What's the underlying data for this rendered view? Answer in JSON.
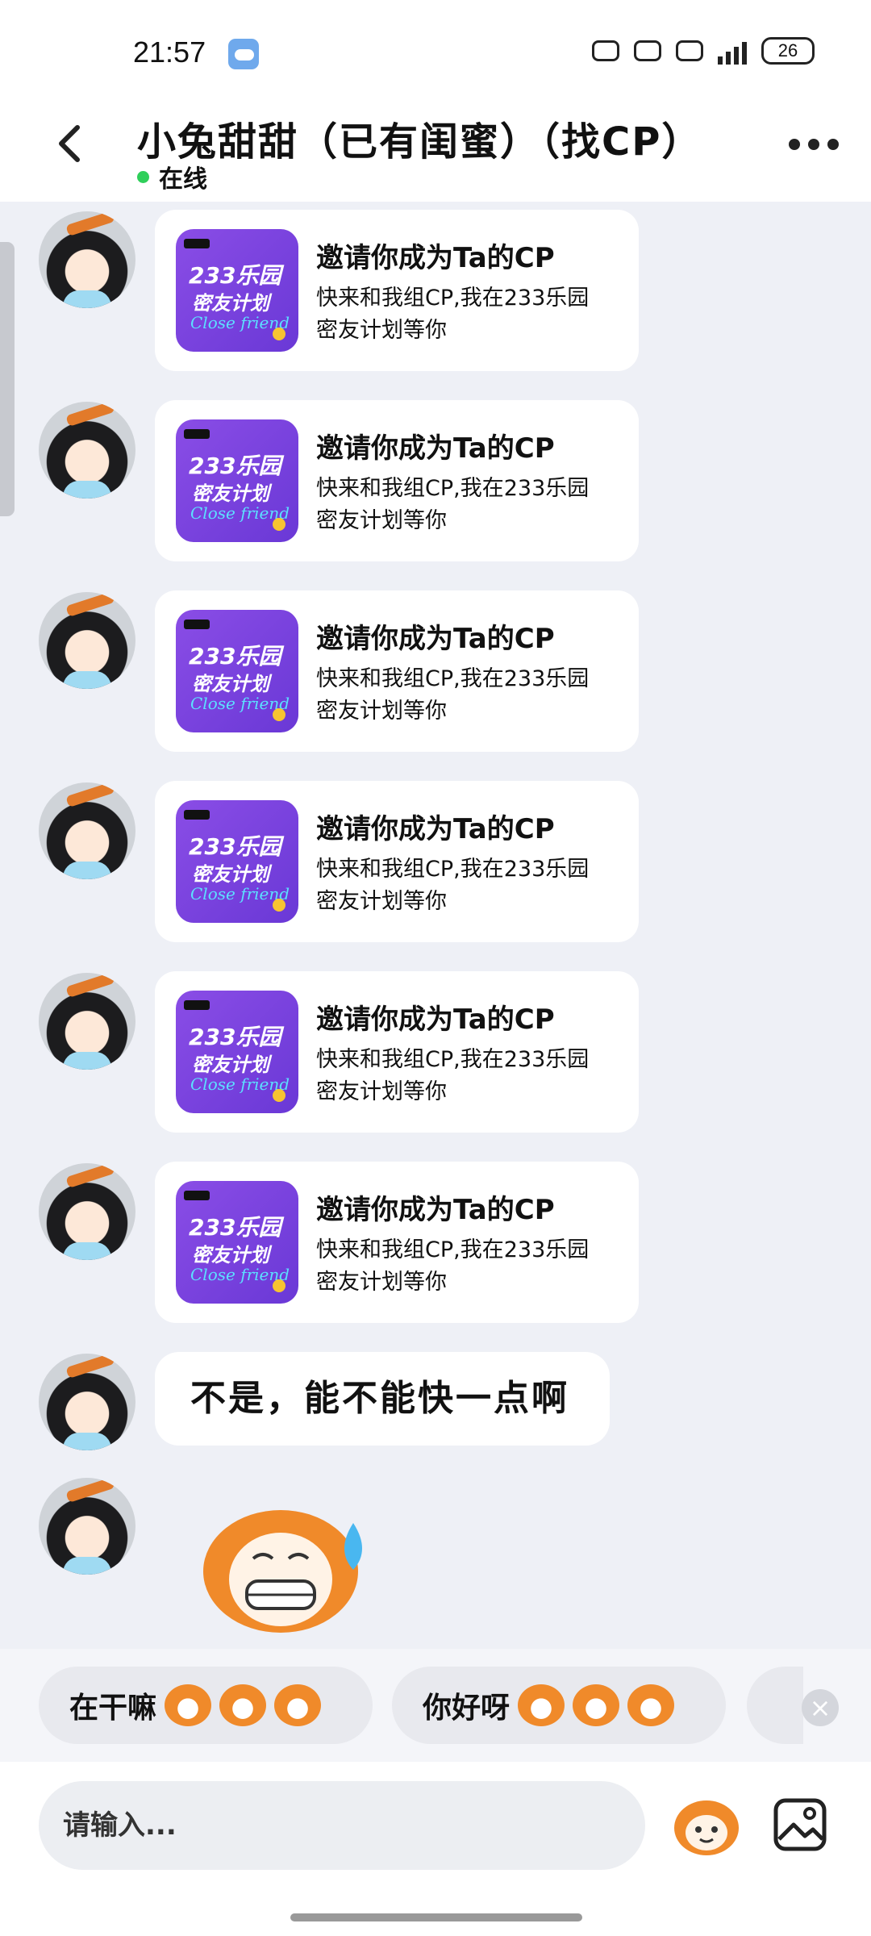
{
  "status_bar": {
    "time": "21:57",
    "battery": "26"
  },
  "header": {
    "title": "小兔甜甜（已有闺蜜）（找CP）",
    "status": "在线"
  },
  "messages": [
    {
      "thumb_line1": "233乐园",
      "thumb_line2": "密友计划",
      "thumb_line3": "Close friend",
      "title": "邀请你成为Ta的CP",
      "desc": "快来和我组CP,我在233乐园\n密友计划等你"
    },
    {
      "thumb_line1": "233乐园",
      "thumb_line2": "密友计划",
      "thumb_line3": "Close friend",
      "title": "邀请你成为Ta的CP",
      "desc": "快来和我组CP,我在233乐园\n密友计划等你"
    },
    {
      "thumb_line1": "233乐园",
      "thumb_line2": "密友计划",
      "thumb_line3": "Close friend",
      "title": "邀请你成为Ta的CP",
      "desc": "快来和我组CP,我在233乐园\n密友计划等你"
    },
    {
      "thumb_line1": "233乐园",
      "thumb_line2": "密友计划",
      "thumb_line3": "Close friend",
      "title": "邀请你成为Ta的CP",
      "desc": "快来和我组CP,我在233乐园\n密友计划等你"
    },
    {
      "thumb_line1": "233乐园",
      "thumb_line2": "密友计划",
      "thumb_line3": "Close friend",
      "title": "邀请你成为Ta的CP",
      "desc": "快来和我组CP,我在233乐园\n密友计划等你"
    },
    {
      "thumb_line1": "233乐园",
      "thumb_line2": "密友计划",
      "thumb_line3": "Close friend",
      "title": "邀请你成为Ta的CP",
      "desc": "快来和我组CP,我在233乐园\n密友计划等你"
    }
  ],
  "text_message": "不是，能不能快一点啊",
  "sticker": "sweating-grin-sticker",
  "quick_replies": [
    {
      "label": "在干嘛",
      "emoji_icon": "grinning-cat-emoji"
    },
    {
      "label": "你好呀",
      "emoji_icon": "surprised-cat-emoji"
    }
  ],
  "input": {
    "placeholder": "请输入..."
  },
  "icons": {
    "back": "back-arrow-icon",
    "more": "more-dots-icon",
    "emoji": "emoji-sticker-icon",
    "image": "image-icon",
    "close": "close-icon"
  }
}
